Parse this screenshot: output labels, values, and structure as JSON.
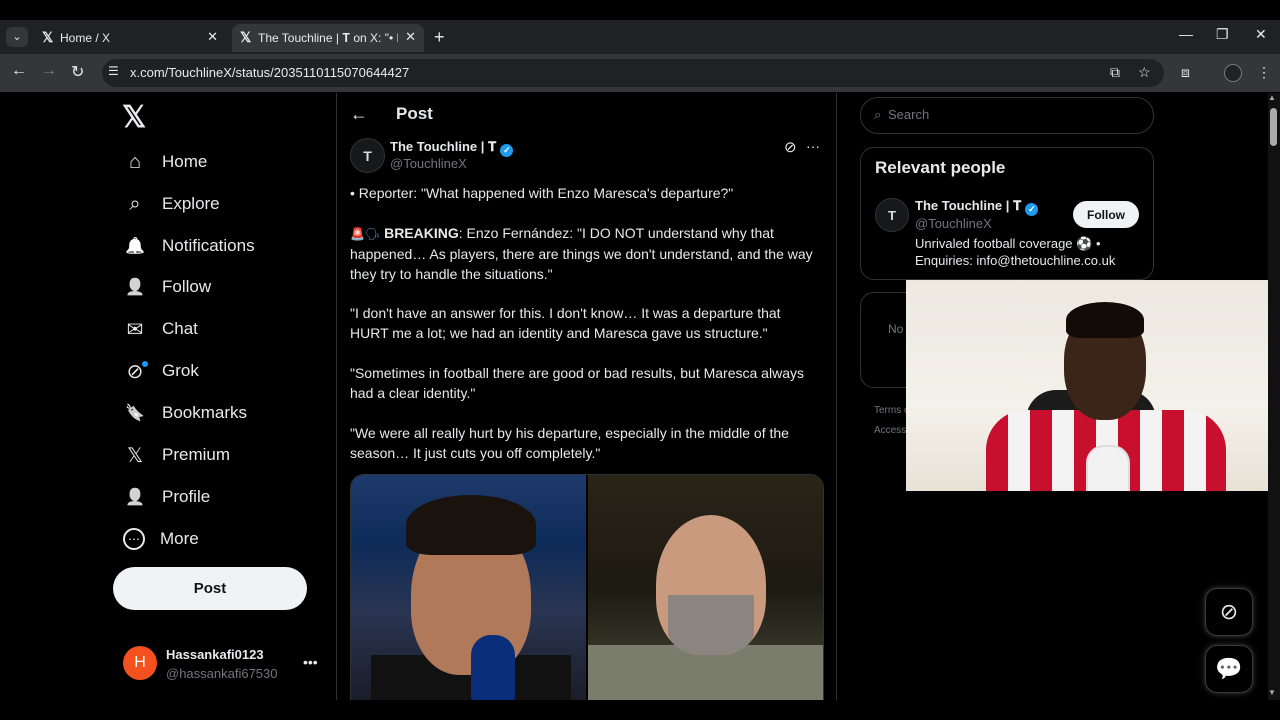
{
  "browser": {
    "tabs": [
      {
        "icon": "𝕏",
        "title": "Home / X"
      },
      {
        "icon": "𝕏",
        "title": "The Touchline | 𝐓 on X: \"• Repo"
      }
    ],
    "url": "x.com/TouchlineX/status/2035110115070644427"
  },
  "sidebar": {
    "logo": "𝕏",
    "items": [
      {
        "icon": "⌂",
        "label": "Home"
      },
      {
        "icon": "⌕",
        "label": "Explore"
      },
      {
        "icon": "🔔",
        "label": "Notifications"
      },
      {
        "icon": "👤",
        "label": "Follow"
      },
      {
        "icon": "✉",
        "label": "Chat"
      },
      {
        "icon": "⊘",
        "label": "Grok"
      },
      {
        "icon": "🔖",
        "label": "Bookmarks"
      },
      {
        "icon": "𝕏",
        "label": "Premium"
      },
      {
        "icon": "👤",
        "label": "Profile"
      },
      {
        "icon": "⋯",
        "label": "More"
      }
    ],
    "post_button": "Post",
    "user": {
      "initial": "H",
      "name": "Hassankafi0123",
      "handle": "@hassankafi67530"
    }
  },
  "main": {
    "header": "Post",
    "tweet": {
      "avatar": "T",
      "name": "The Touchline | 𝐓",
      "handle": "@TouchlineX",
      "line1": "• Reporter: \"What happened with Enzo Maresca's departure?\"",
      "p2_bold": "BREAKING",
      "p2_rest": ": Enzo Fernández: \"I DO NOT understand why that happened… As players, there are things we don't understand, and the way they try to handle the situations.\"",
      "p3": "\"I don't have an answer for this. I don't know… It was a departure that HURT me a lot; we had an identity and Maresca gave us structure.\"",
      "p4": "\"Sometimes in football there are good or bad results, but Maresca always had a clear identity.\"",
      "p5": "\"We were all really hurt by his departure, especially in the middle of the season… It just cuts you off completely.\""
    }
  },
  "right": {
    "search_placeholder": "Search",
    "relevant_title": "Relevant people",
    "person": {
      "avatar": "T",
      "name": "The Touchline | 𝐓",
      "handle": "@TouchlineX",
      "follow": "Follow",
      "bio": "Unrivaled football coverage ⚽ • Enquiries: info@thetouchline.co.uk"
    },
    "box2_partial": "No",
    "footer_partial_1": "Terms o",
    "footer_partial_2": "Access"
  },
  "colors": {
    "accent": "#1d9bf0",
    "background": "#000000",
    "text": "#e7e9ea",
    "muted": "#71767b"
  }
}
